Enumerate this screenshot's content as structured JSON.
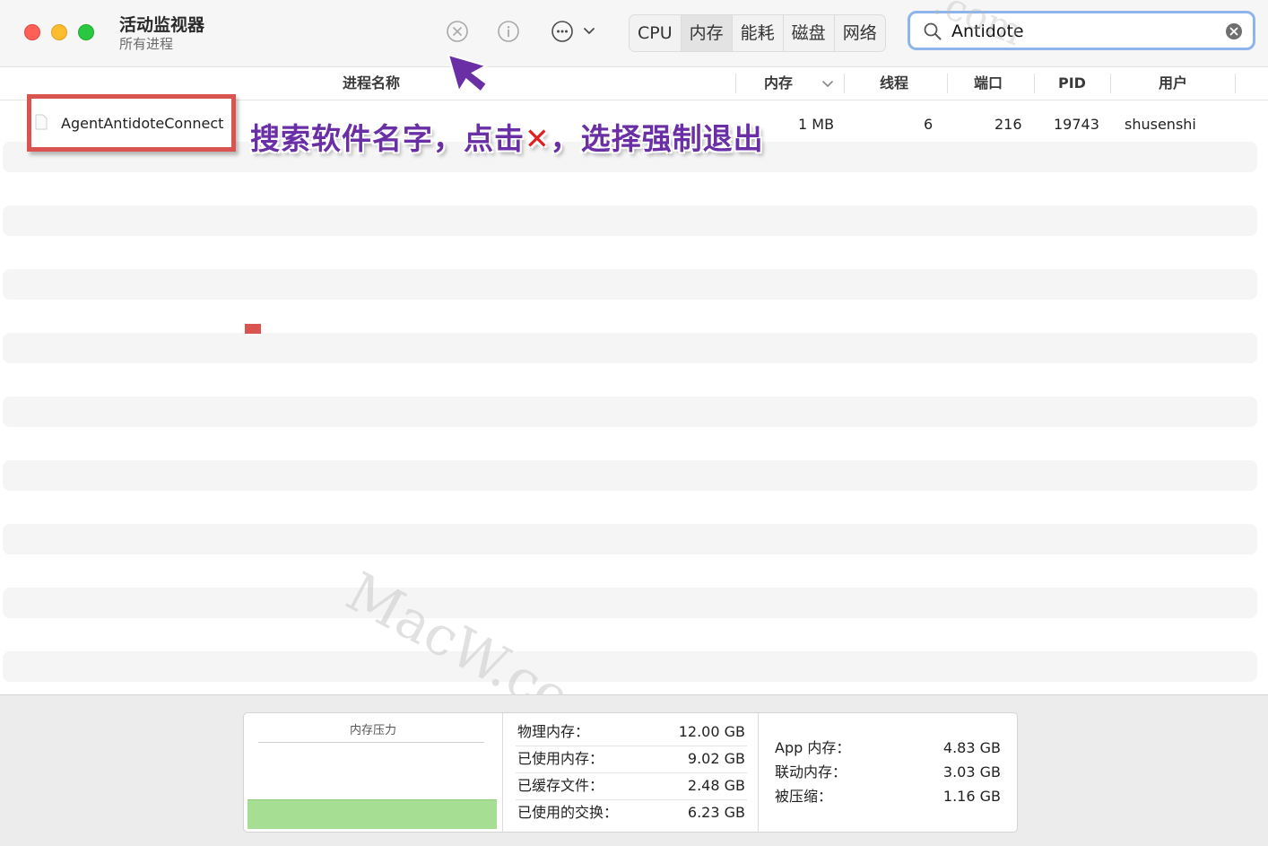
{
  "window": {
    "title": "活动监视器",
    "subtitle": "所有进程"
  },
  "toolbar": {
    "stop_icon": "stop-process-icon",
    "info_icon": "info-icon",
    "more_icon": "ellipsis-circle-icon",
    "tabs": [
      "CPU",
      "内存",
      "能耗",
      "磁盘",
      "网络"
    ],
    "active_tab": "内存",
    "search": {
      "value": "Antidote"
    }
  },
  "columns": {
    "name": "进程名称",
    "memory": "内存",
    "threads": "线程",
    "ports": "端口",
    "pid": "PID",
    "user": "用户"
  },
  "process": {
    "name": "AgentAntidoteConnect",
    "memory": "1 MB",
    "threads": "6",
    "ports": "216",
    "pid": "19743",
    "user": "shusenshi"
  },
  "annotation": {
    "part1": "搜索软件名字，点击",
    "x_mark": "✕",
    "part2": "，选择强制退出",
    "color": "#6a2fa5"
  },
  "watermark": {
    "text": "MacW.com",
    "top_text": ".com"
  },
  "memory_panel": {
    "pressure_title": "内存压力",
    "pressure_level": 0.28,
    "pressure_color": "#a6df94",
    "stats": [
      {
        "label": "物理内存：",
        "value": "12.00 GB"
      },
      {
        "label": "已使用内存：",
        "value": "9.02 GB"
      },
      {
        "label": "已缓存文件：",
        "value": "2.48 GB"
      },
      {
        "label": "已使用的交换：",
        "value": "6.23 GB"
      }
    ],
    "breakdown": [
      {
        "label": "App 内存：",
        "value": "4.83 GB"
      },
      {
        "label": "联动内存：",
        "value": "3.03 GB"
      },
      {
        "label": "被压缩：",
        "value": "1.16 GB"
      }
    ]
  }
}
